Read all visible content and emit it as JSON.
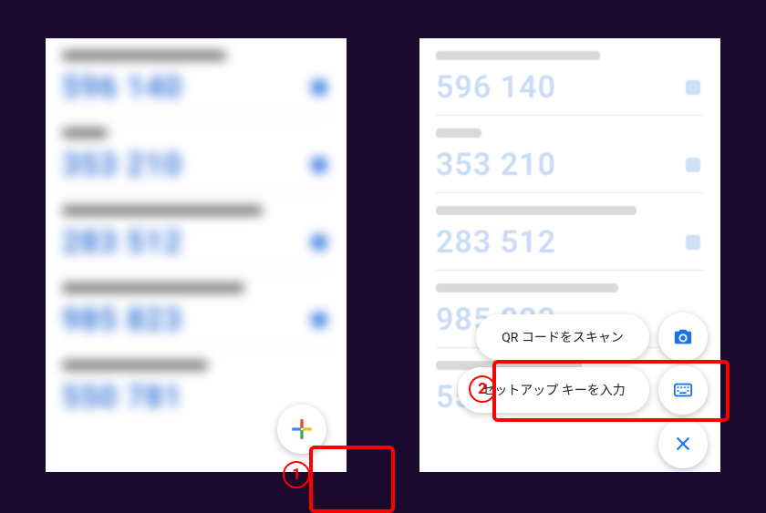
{
  "codes": [
    "596 140",
    "353 210",
    "283 512",
    "985 823",
    "550 781"
  ],
  "acct_widths": [
    180,
    50,
    220,
    200,
    160
  ],
  "menu": {
    "scan_qr": "QR コードをスキャン",
    "enter_key": "セットアップ キーを入力"
  },
  "annotations": {
    "one": "1",
    "two": "2"
  }
}
